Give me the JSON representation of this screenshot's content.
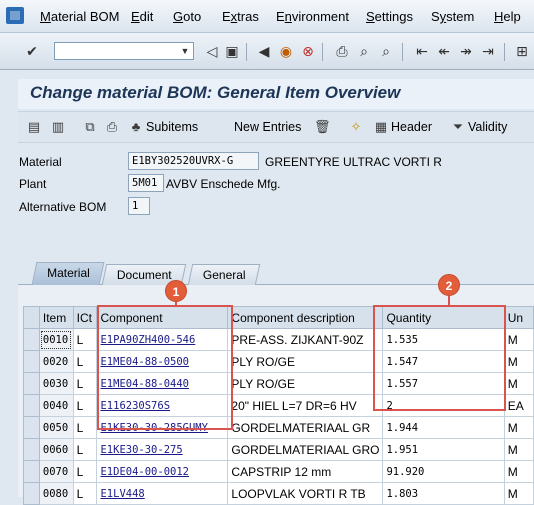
{
  "menu": {
    "items": [
      {
        "label": "Material BOM",
        "u": "M"
      },
      {
        "label": "Edit",
        "u": "E"
      },
      {
        "label": "Goto",
        "u": "G"
      },
      {
        "label": "Extras",
        "u": "x"
      },
      {
        "label": "Environment",
        "u": "n"
      },
      {
        "label": "Settings",
        "u": "S"
      },
      {
        "label": "System",
        "u": "y"
      },
      {
        "label": "Help",
        "u": "H"
      }
    ]
  },
  "toolbar": {
    "command_field_value": ""
  },
  "title": "Change material BOM: General Item Overview",
  "app_toolbar": {
    "subitems_label": "Subitems",
    "new_entries_label": "New Entries",
    "header_label": "Header",
    "validity_label": "Validity"
  },
  "header": {
    "material_label": "Material",
    "material_value": "E1BY302520UVRX-G",
    "material_desc": "GREENTYRE  ULTRAC VORTI R",
    "plant_label": "Plant",
    "plant_value": "5M01",
    "plant_desc": "AVBV Enschede Mfg.",
    "altbom_label": "Alternative BOM",
    "altbom_value": "1"
  },
  "tabs": [
    {
      "label": "Material",
      "active": true
    },
    {
      "label": "Document",
      "active": false
    },
    {
      "label": "General",
      "active": false
    }
  ],
  "table": {
    "columns": [
      "Item",
      "ICt",
      "Component",
      "Component description",
      "Quantity",
      "Un"
    ],
    "rows": [
      {
        "item": "0010",
        "ict": "L",
        "component": "E1PA90ZH400-546",
        "desc": "PRE-ASS.  ZIJKANT-90Z",
        "qty": "1.535",
        "un": "M"
      },
      {
        "item": "0020",
        "ict": "L",
        "component": "E1ME04-88-0500",
        "desc": "PLY RO/GE",
        "qty": "1.547",
        "un": "M"
      },
      {
        "item": "0030",
        "ict": "L",
        "component": "E1ME04-88-0440",
        "desc": "PLY RO/GE",
        "qty": "1.557",
        "un": "M"
      },
      {
        "item": "0040",
        "ict": "L",
        "component": "E116230S76S",
        "desc": "20\" HIEL  L=7 DR=6 HV",
        "qty": "2",
        "un": "EA"
      },
      {
        "item": "0050",
        "ict": "L",
        "component": "E1KE30-30-285GUMY",
        "desc": "GORDELMATERIAAL GR",
        "qty": "1.944",
        "un": "M"
      },
      {
        "item": "0060",
        "ict": "L",
        "component": "E1KE30-30-275",
        "desc": "GORDELMATERIAAL GRO",
        "qty": "1.951",
        "un": "M"
      },
      {
        "item": "0070",
        "ict": "L",
        "component": "E1DE04-00-0012",
        "desc": "CAPSTRIP 12 mm",
        "qty": "91.920",
        "un": "M"
      },
      {
        "item": "0080",
        "ict": "L",
        "component": "E1LV448",
        "desc": "LOOPVLAK VORTI R TB",
        "qty": "1.803",
        "un": "M"
      }
    ]
  },
  "annotations": [
    {
      "number": "1",
      "target": "Component"
    },
    {
      "number": "2",
      "target": "Quantity"
    }
  ],
  "colors": {
    "accent_red": "#d9534f",
    "title_blue": "#1d3557"
  }
}
